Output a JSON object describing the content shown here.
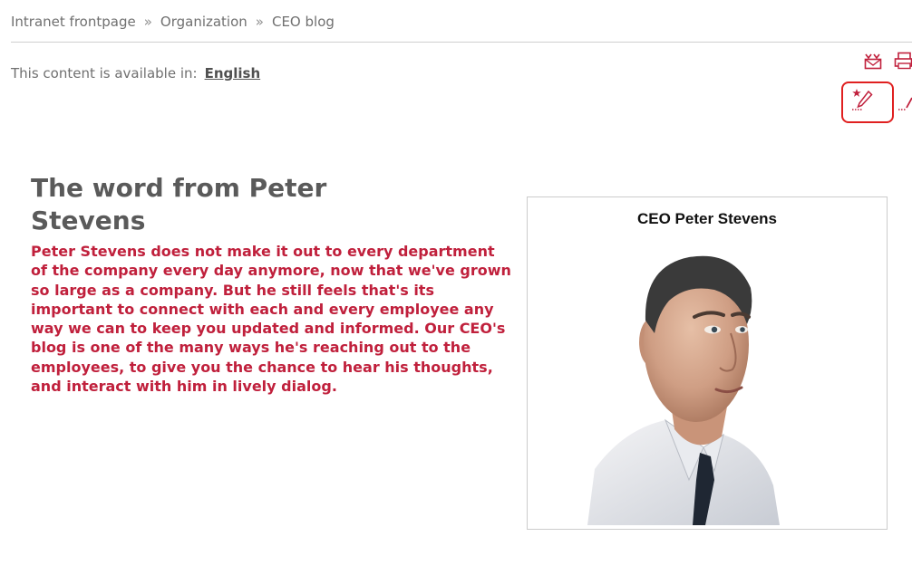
{
  "breadcrumb": {
    "items": [
      "Intranet frontpage",
      "Organization",
      "CEO blog"
    ],
    "separator": "»"
  },
  "language_bar": {
    "label": "This content is available in:",
    "language": "English"
  },
  "toolbar": {
    "icons": [
      "send-email-icon",
      "print-icon",
      "edit-page-icon",
      "more-edit-icon"
    ],
    "accent_color": "#c0203c",
    "highlight_color": "#e02020"
  },
  "article": {
    "title": "The word from Peter Stevens",
    "intro": "Peter Stevens does not make it out to every department of the company every day anymore, now that we've grown so large as a company. But he still feels that's its important to connect with each and every employee any way we can to keep you updated and informed. Our CEO's blog is one of the many ways he's reaching out to the employees, to give you the chance to hear his thoughts, and interact with him in lively dialog."
  },
  "photo": {
    "caption": "CEO Peter Stevens"
  }
}
